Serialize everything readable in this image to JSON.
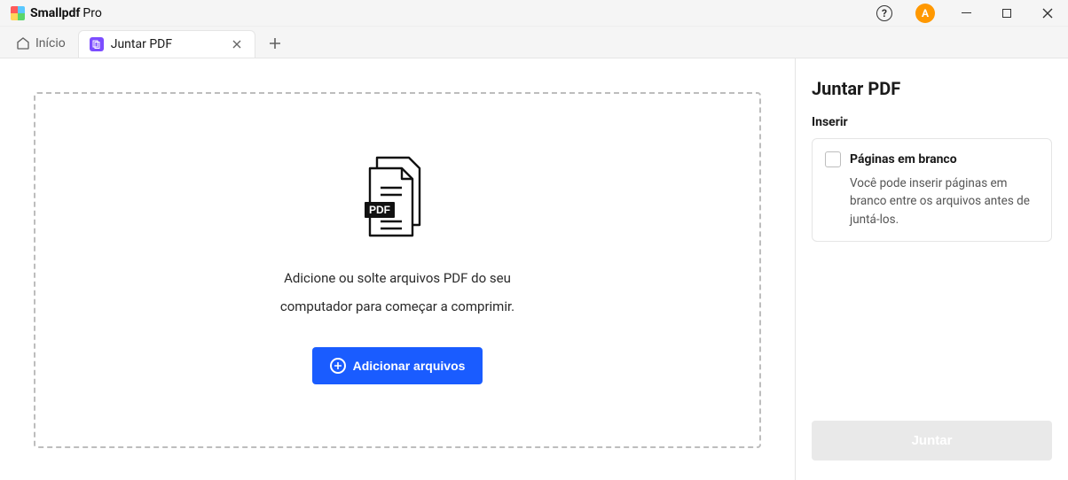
{
  "app": {
    "name": "Smallpdf",
    "edition": "Pro",
    "avatar_initial": "A"
  },
  "nav": {
    "home_label": "Início"
  },
  "tab": {
    "label": "Juntar PDF"
  },
  "dropzone": {
    "line1": "Adicione ou solte arquivos PDF do seu",
    "line2": "computador para começar a comprimir.",
    "button_label": "Adicionar arquivos"
  },
  "sidebar": {
    "title": "Juntar PDF",
    "insert_label": "Inserir",
    "card": {
      "title": "Páginas em branco",
      "desc": "Você pode inserir páginas em branco entre os arquivos antes de juntá-los."
    },
    "merge_button": "Juntar"
  }
}
